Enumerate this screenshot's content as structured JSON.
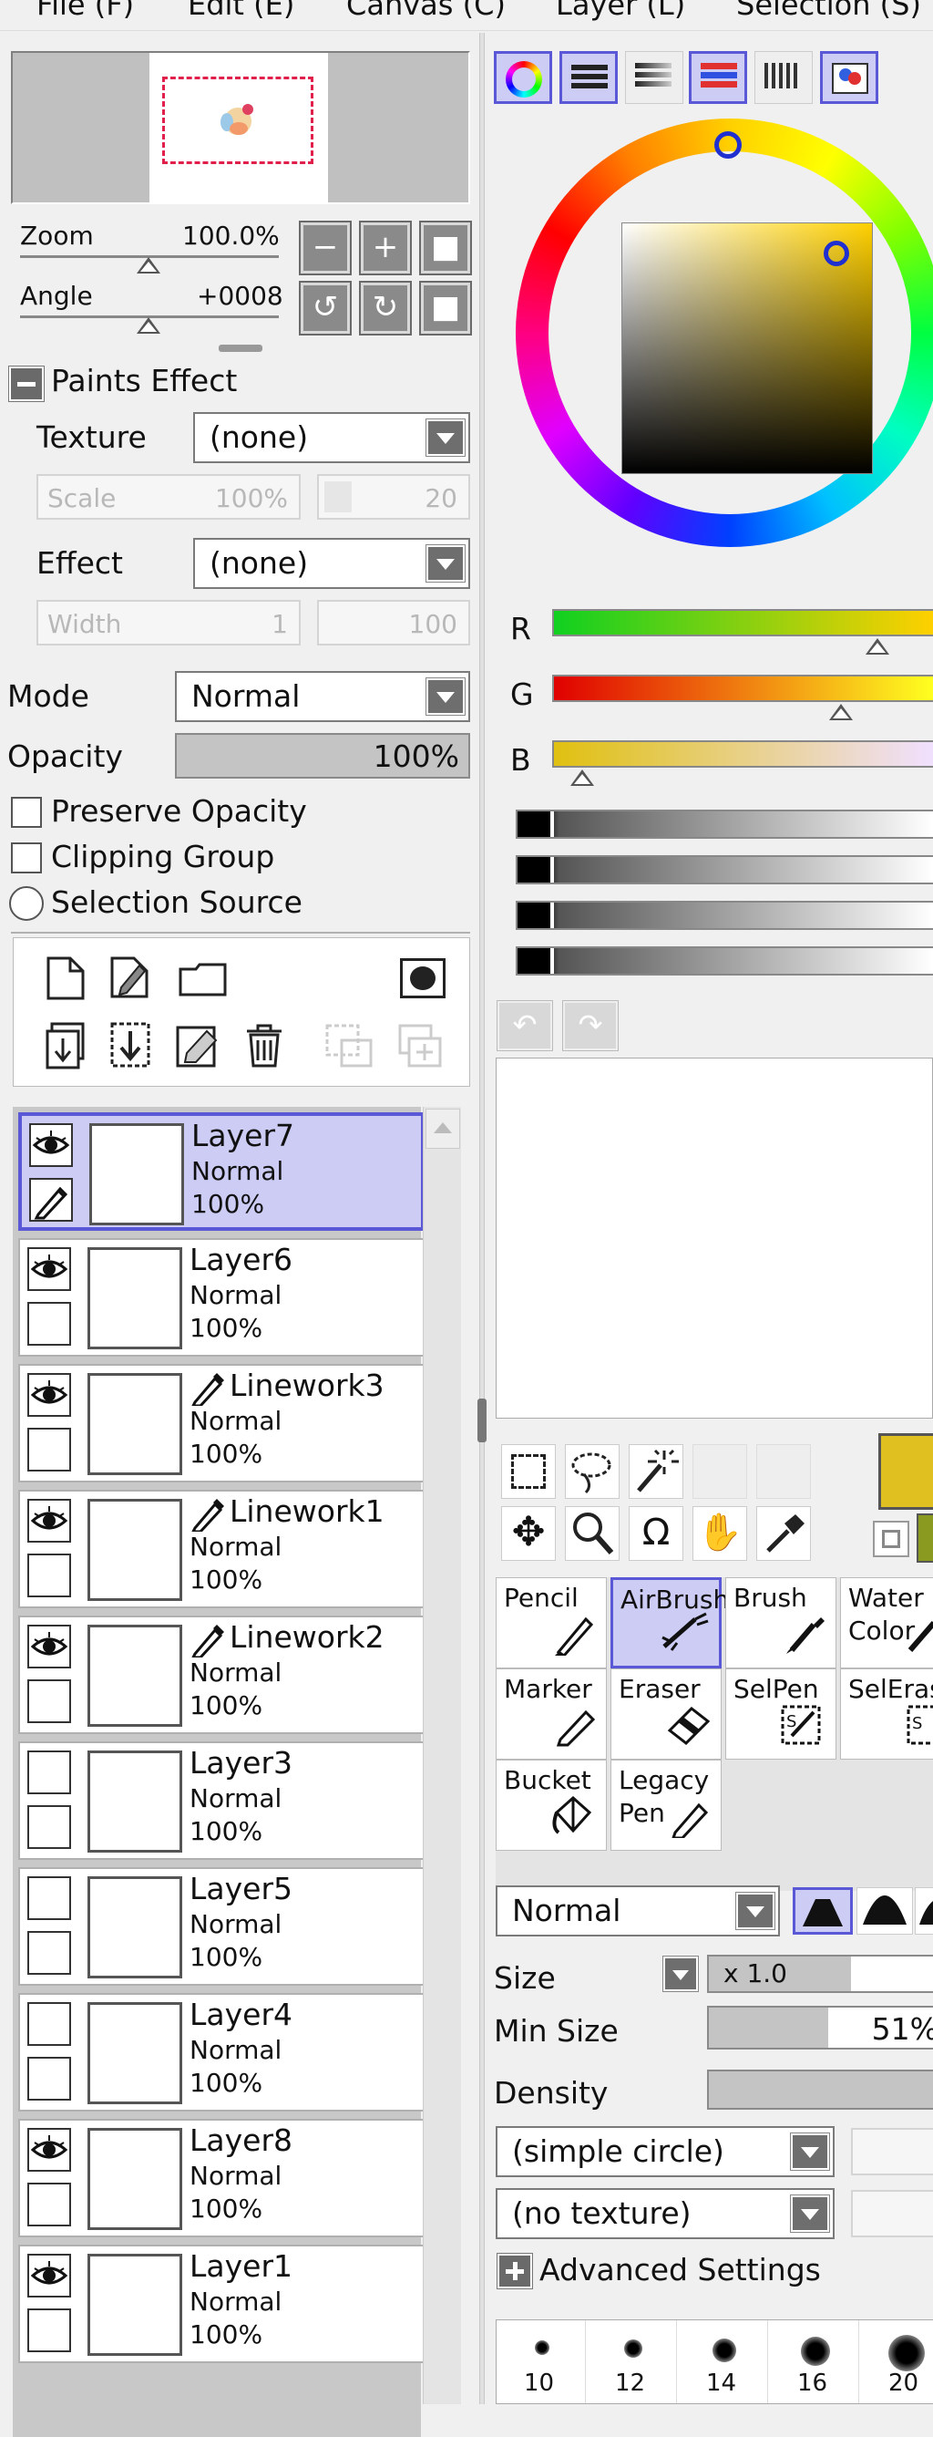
{
  "menu": [
    "File (F)",
    "Edit (E)",
    "Canvas (C)",
    "Layer (L)",
    "Selection (S)"
  ],
  "navigator": {
    "zoom_label": "Zoom",
    "zoom_value": "100.0%",
    "angle_label": "Angle",
    "angle_value": "+0008"
  },
  "paints_effect": {
    "header": "Paints Effect",
    "texture_label": "Texture",
    "texture_value": "(none)",
    "scale_label": "Scale",
    "scale_value": "100%",
    "scale_right": "20",
    "effect_label": "Effect",
    "effect_value": "(none)",
    "width_label": "Width",
    "width_value": "1",
    "width_right": "100"
  },
  "layer_props": {
    "mode_label": "Mode",
    "mode_value": "Normal",
    "opacity_label": "Opacity",
    "opacity_value": "100%",
    "preserve_opacity": "Preserve Opacity",
    "clipping_group": "Clipping Group",
    "selection_source": "Selection Source"
  },
  "layers": [
    {
      "name": "Layer7",
      "mode": "Normal",
      "opacity": "100%",
      "visible": true,
      "selected": true,
      "linework": false
    },
    {
      "name": "Layer6",
      "mode": "Normal",
      "opacity": "100%",
      "visible": true,
      "selected": false,
      "linework": false
    },
    {
      "name": "Linework3",
      "mode": "Normal",
      "opacity": "100%",
      "visible": true,
      "selected": false,
      "linework": true
    },
    {
      "name": "Linework1",
      "mode": "Normal",
      "opacity": "100%",
      "visible": true,
      "selected": false,
      "linework": true
    },
    {
      "name": "Linework2",
      "mode": "Normal",
      "opacity": "100%",
      "visible": true,
      "selected": false,
      "linework": true
    },
    {
      "name": "Layer3",
      "mode": "Normal",
      "opacity": "100%",
      "visible": false,
      "selected": false,
      "linework": false
    },
    {
      "name": "Layer5",
      "mode": "Normal",
      "opacity": "100%",
      "visible": false,
      "selected": false,
      "linework": false
    },
    {
      "name": "Layer4",
      "mode": "Normal",
      "opacity": "100%",
      "visible": false,
      "selected": false,
      "linework": false
    },
    {
      "name": "Layer8",
      "mode": "Normal",
      "opacity": "100%",
      "visible": true,
      "selected": false,
      "linework": false
    },
    {
      "name": "Layer1",
      "mode": "Normal",
      "opacity": "100%",
      "visible": true,
      "selected": false,
      "linework": false
    }
  ],
  "color": {
    "r_label": "R",
    "g_label": "G",
    "b_label": "B",
    "current_color": "#e0c020"
  },
  "tools": [
    {
      "label": "Pencil",
      "active": false
    },
    {
      "label": "AirBrush",
      "active": true
    },
    {
      "label": "Brush",
      "active": false
    },
    {
      "label": "Water Color",
      "active": false
    },
    {
      "label": "Marker",
      "active": false
    },
    {
      "label": "Eraser",
      "active": false
    },
    {
      "label": "SelPen",
      "active": false
    },
    {
      "label": "SelEras",
      "active": false
    },
    {
      "label": "Bucket",
      "active": false
    },
    {
      "label": "Legacy Pen",
      "active": false
    }
  ],
  "tool_settings": {
    "blend_mode": "Normal",
    "size_label": "Size",
    "size_multiplier": "x 1.0",
    "min_size_label": "Min Size",
    "min_size_value": "51%",
    "density_label": "Density",
    "shape_value": "(simple circle)",
    "texture_value": "(no texture)",
    "advanced_settings": "Advanced Settings",
    "brush_sizes": [
      "10",
      "12",
      "14",
      "16",
      "20"
    ]
  }
}
